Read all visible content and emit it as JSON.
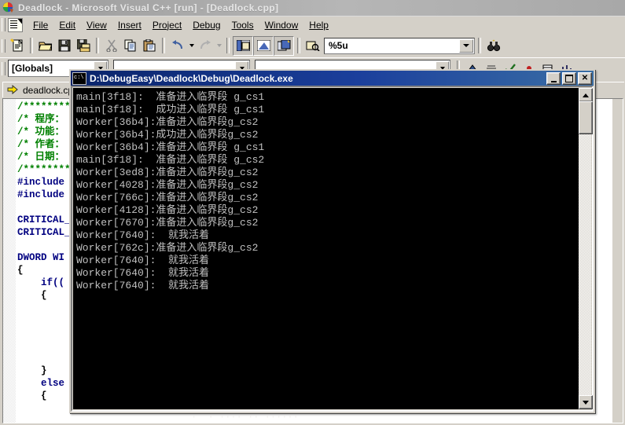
{
  "window": {
    "title": "Deadlock - Microsoft Visual C++ [run] - [Deadlock.cpp]",
    "app_icon": "vc-logo-icon"
  },
  "menubar": {
    "doc_icon": "document-icon",
    "items": [
      {
        "label": "File",
        "accel": "F"
      },
      {
        "label": "Edit",
        "accel": "E"
      },
      {
        "label": "View",
        "accel": "V"
      },
      {
        "label": "Insert",
        "accel": "I"
      },
      {
        "label": "Project",
        "accel": "P"
      },
      {
        "label": "Debug",
        "accel": "D"
      },
      {
        "label": "Tools",
        "accel": "T"
      },
      {
        "label": "Window",
        "accel": "W"
      },
      {
        "label": "Help",
        "accel": "H"
      }
    ]
  },
  "toolbar": {
    "buttons": [
      {
        "name": "new-text-file-icon"
      },
      {
        "name": "open-folder-icon"
      },
      {
        "name": "save-icon"
      },
      {
        "name": "save-all-icon"
      },
      {
        "name": "cut-scissors-icon"
      },
      {
        "name": "copy-icon"
      },
      {
        "name": "paste-icon"
      },
      {
        "name": "undo-icon"
      },
      {
        "name": "redo-icon"
      },
      {
        "name": "workspace-window-icon"
      },
      {
        "name": "output-window-icon"
      },
      {
        "name": "window-list-icon"
      },
      {
        "name": "find-in-files-icon"
      }
    ],
    "find_combo": {
      "value": "%5u",
      "placeholder": "",
      "dropdown_icon": "chevron-down-icon"
    },
    "find_button_icon": "binoculars-icon"
  },
  "wizardbar": {
    "globals_combo": {
      "value": "[Globals]",
      "dropdown_icon": "chevron-down-icon"
    },
    "class_combo": {
      "value": "",
      "dropdown_icon": "chevron-down-icon"
    },
    "member_combo": {
      "value": "",
      "dropdown_icon": "chevron-down-icon"
    },
    "debug_buttons": [
      {
        "name": "restart-icon"
      },
      {
        "name": "stop-debugging-icon"
      },
      {
        "name": "break-execution-icon"
      },
      {
        "name": "step-into-icon"
      },
      {
        "name": "show-next-statement-icon"
      },
      {
        "name": "quickwatch-icon"
      }
    ]
  },
  "editor": {
    "tab": {
      "arrow_icon": "current-statement-arrow-icon",
      "label": "deadlock.cpp"
    },
    "code_lines": [
      {
        "text": "/*********",
        "cls": "cmt"
      },
      {
        "text": "/* 程序：",
        "cls": "cmt"
      },
      {
        "text": "/* 功能：",
        "cls": "cmt"
      },
      {
        "text": "/* 作者：",
        "cls": "cmt"
      },
      {
        "text": "/* 日期：",
        "cls": "cmt"
      },
      {
        "text": "/*********",
        "cls": "cmt"
      },
      {
        "text": "#include ",
        "cls": "pp"
      },
      {
        "text": "#include ",
        "cls": "pp"
      },
      {
        "text": "",
        "cls": "pl"
      },
      {
        "text": "CRITICAL_",
        "cls": "kw"
      },
      {
        "text": "CRITICAL_",
        "cls": "kw"
      },
      {
        "text": "",
        "cls": "pl"
      },
      {
        "text": "DWORD WI",
        "cls": "kw"
      },
      {
        "text": "{",
        "cls": "pl"
      },
      {
        "text": "    if((",
        "cls": "kw"
      },
      {
        "text": "    {",
        "cls": "pl"
      },
      {
        "text": "",
        "cls": "pl"
      },
      {
        "text": "",
        "cls": "pl"
      },
      {
        "text": "",
        "cls": "pl"
      },
      {
        "text": "",
        "cls": "pl"
      },
      {
        "text": "",
        "cls": "pl"
      },
      {
        "text": "    }",
        "cls": "pl"
      },
      {
        "text": "    else",
        "cls": "kw"
      },
      {
        "text": "    {",
        "cls": "pl"
      }
    ],
    "faint_text": "·  · ···· ·· ······"
  },
  "console": {
    "icon": "cmd-console-icon",
    "title": "D:\\DebugEasy\\Deadlock\\Debug\\Deadlock.exe",
    "window_buttons": [
      {
        "name": "minimize-button",
        "glyph": ""
      },
      {
        "name": "maximize-button",
        "glyph": ""
      },
      {
        "name": "close-button",
        "glyph": "✕"
      }
    ],
    "scrollbar": {
      "up_icon": "scroll-up-arrow-icon",
      "down_icon": "scroll-down-arrow-icon",
      "thumb_name": "scroll-thumb"
    },
    "lines": [
      "main[3f18]:  准备进入临界段 g_cs1",
      "main[3f18]:  成功进入临界段 g_cs1",
      "Worker[36b4]:准备进入临界段g_cs2",
      "Worker[36b4]:成功进入临界段g_cs2",
      "Worker[36b4]:准备进入临界段 g_cs1",
      "main[3f18]:  准备进入临界段 g_cs2",
      "Worker[3ed8]:准备进入临界段g_cs2",
      "Worker[4028]:准备进入临界段g_cs2",
      "Worker[766c]:准备进入临界段g_cs2",
      "Worker[4128]:准备进入临界段g_cs2",
      "Worker[7670]:准备进入临界段g_cs2",
      "Worker[7640]:  就我活着",
      "Worker[762c]:准备进入临界段g_cs2",
      "Worker[7640]:  就我活着",
      "Worker[7640]:  就我活着",
      "Worker[7640]:  就我活着"
    ]
  },
  "colors": {
    "face": "#d4d0c8",
    "console_bg": "#000000",
    "console_fg": "#c0c0c0",
    "title_active_start": "#0a246a",
    "title_active_end": "#3a6ea5",
    "title_inactive": "#9a9a9a",
    "comment_green": "#008000",
    "keyword_navy": "#000080"
  }
}
